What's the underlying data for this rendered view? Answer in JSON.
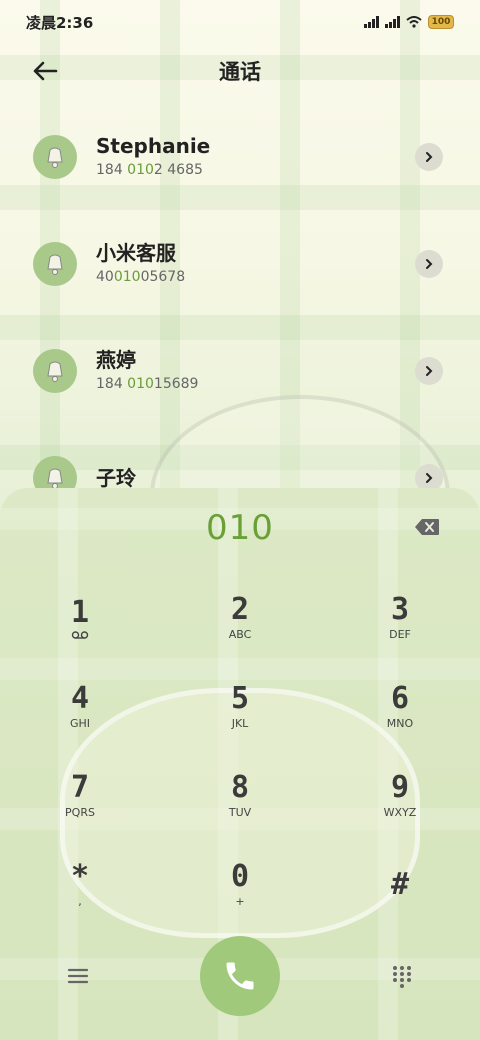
{
  "status_bar": {
    "time": "凌晨2:36",
    "battery_text": "100"
  },
  "header": {
    "title": "通话"
  },
  "contacts": [
    {
      "name": "Stephanie",
      "num_pre": "184 ",
      "num_hl": "010",
      "num_post": "2 4685"
    },
    {
      "name": "小米客服",
      "num_pre": "40",
      "num_hl": "010",
      "num_post": "05678"
    },
    {
      "name": "燕婷",
      "num_pre": "184 ",
      "num_hl": "010",
      "num_post": "15689"
    },
    {
      "name": "子玲",
      "num_pre": "",
      "num_hl": "",
      "num_post": ""
    }
  ],
  "dialpad": {
    "number": "010",
    "keys": [
      {
        "digit": "1",
        "letters": ""
      },
      {
        "digit": "2",
        "letters": "ABC"
      },
      {
        "digit": "3",
        "letters": "DEF"
      },
      {
        "digit": "4",
        "letters": "GHI"
      },
      {
        "digit": "5",
        "letters": "JKL"
      },
      {
        "digit": "6",
        "letters": "MNO"
      },
      {
        "digit": "7",
        "letters": "PQRS"
      },
      {
        "digit": "8",
        "letters": "TUV"
      },
      {
        "digit": "9",
        "letters": "WXYZ"
      },
      {
        "digit": "*",
        "letters": ","
      },
      {
        "digit": "0",
        "letters": "+"
      },
      {
        "digit": "#",
        "letters": ""
      }
    ]
  },
  "colors": {
    "accent": "#6aa038",
    "call_button": "#a1c97c",
    "avatar": "#a8c98a"
  },
  "icons": {
    "back": "arrow-left-icon",
    "chevron": "chevron-right-icon",
    "backspace": "backspace-icon",
    "voicemail": "voicemail-icon",
    "menu": "menu-icon",
    "call": "phone-icon",
    "dialpad": "dialpad-grid-icon"
  }
}
